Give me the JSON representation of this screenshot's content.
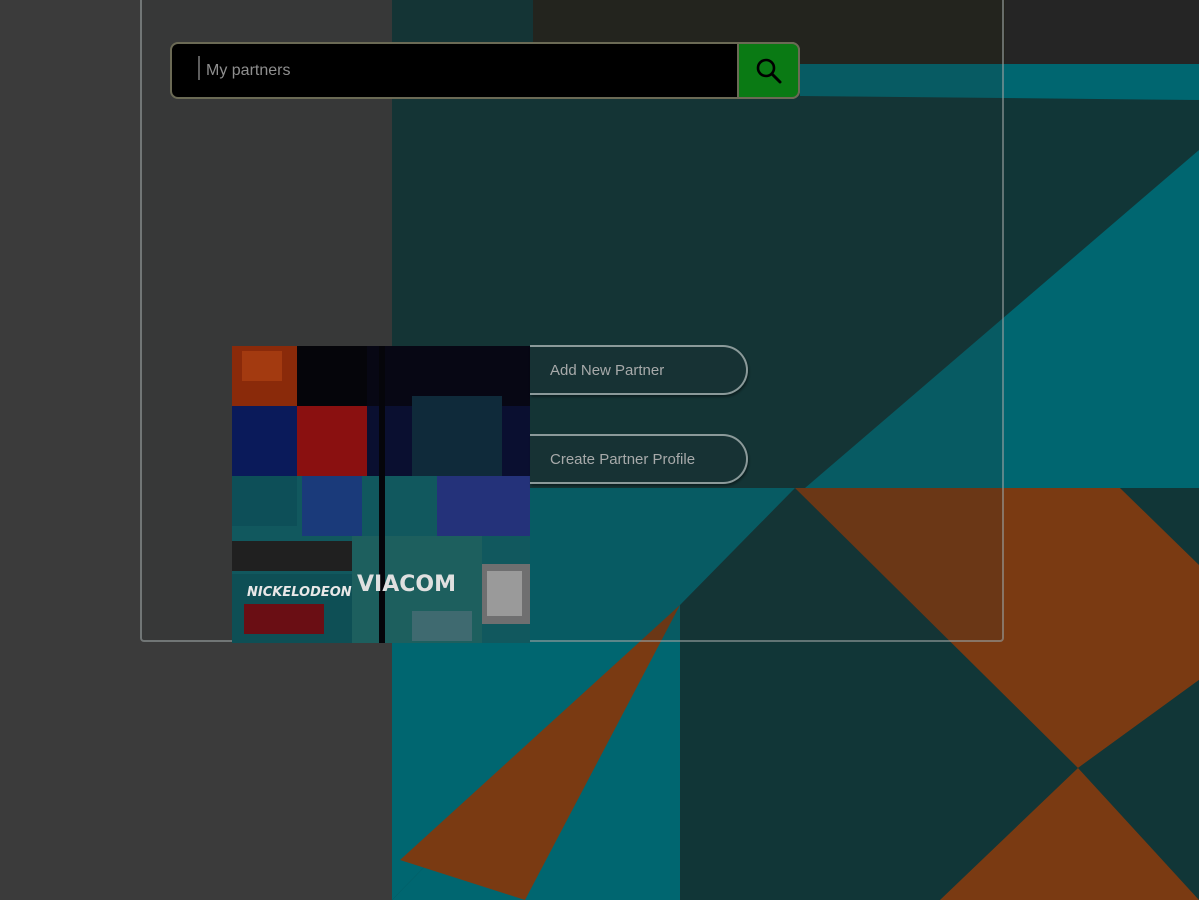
{
  "search": {
    "placeholder": "My partners",
    "button_icon": "search-icon"
  },
  "actions": {
    "add_partner_label": "Add New Partner",
    "create_profile_label": "Create Partner Profile"
  },
  "image": {
    "logo_texts": [
      "NICKELODEON",
      "VIACOM"
    ]
  },
  "colors": {
    "search_button": "#0a7a14",
    "teal": "#006670",
    "dark_teal": "#113637",
    "orange": "#7a3a12",
    "left_panel": "#3a3a3a"
  }
}
